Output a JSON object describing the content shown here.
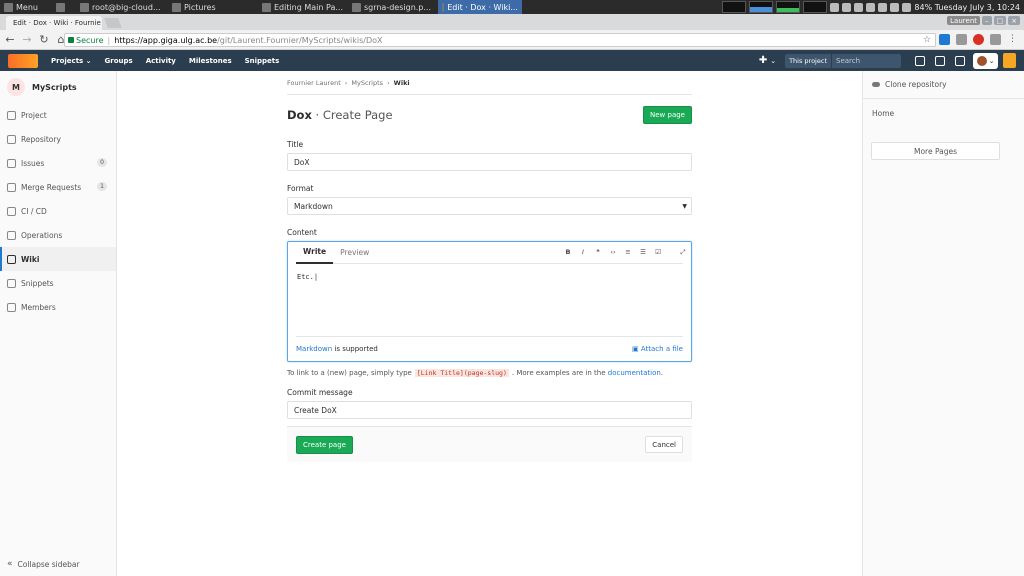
{
  "taskbar": {
    "menu": "Menu",
    "windows": [
      "root@big-cloud...",
      "Pictures",
      "Editing Main Pa...",
      "sgrna-design.p...",
      "Edit · Dox · Wiki..."
    ],
    "status": "84%  Tuesday July  3, 10:24"
  },
  "browser": {
    "tab_title": "Edit · Dox · Wiki · Fournie",
    "user_label": "Laurent",
    "secure_label": "Secure",
    "url_scheme_host": "https://app.giga.ulg.ac.be",
    "url_path": "/git/Laurent.Fournier/MyScripts/wikis/DoX"
  },
  "gitlab_nav": {
    "links": [
      "Projects",
      "Groups",
      "Activity",
      "Milestones",
      "Snippets"
    ],
    "this_project": "This project",
    "search_placeholder": "Search"
  },
  "sidebar": {
    "project_initial": "M",
    "project_name": "MyScripts",
    "items": [
      {
        "label": "Project",
        "icon": "home-icon"
      },
      {
        "label": "Repository",
        "icon": "doc-icon"
      },
      {
        "label": "Issues",
        "icon": "issues-icon",
        "badge": "0"
      },
      {
        "label": "Merge Requests",
        "icon": "merge-icon",
        "badge": "1"
      },
      {
        "label": "CI / CD",
        "icon": "rocket-icon"
      },
      {
        "label": "Operations",
        "icon": "cloud-icon"
      },
      {
        "label": "Wiki",
        "icon": "book-icon",
        "active": true
      },
      {
        "label": "Snippets",
        "icon": "snippet-icon"
      },
      {
        "label": "Members",
        "icon": "users-icon"
      }
    ],
    "collapse_label": "Collapse sidebar"
  },
  "breadcrumb": {
    "items": [
      "Fournier Laurent",
      "MyScripts",
      "Wiki"
    ],
    "separator": "›"
  },
  "page": {
    "title_bold": "Dox",
    "title_rest": " · Create Page",
    "new_page_label": "New page"
  },
  "form": {
    "title_label": "Title",
    "title_value": "DoX",
    "format_label": "Format",
    "format_value": "Markdown",
    "content_label": "Content",
    "write_tab": "Write",
    "preview_tab": "Preview",
    "tools": [
      "B",
      "I",
      "❝",
      "‹›",
      "≡",
      "☰",
      "☑",
      "⤢"
    ],
    "content_value": "Etc.",
    "markdown_link": "Markdown",
    "supported_text": " is supported",
    "attach_label": "Attach a file",
    "help_prefix": "To link to a (new) page, simply type",
    "help_code": "[Link Title](page-slug)",
    "help_middle": ". More examples are in the",
    "help_link": "documentation",
    "help_suffix": ".",
    "commit_label": "Commit message",
    "commit_value": "Create DoX",
    "create_label": "Create page",
    "cancel_label": "Cancel"
  },
  "right_sidebar": {
    "clone_label": "Clone repository",
    "home_label": "Home",
    "more_label": "More Pages"
  }
}
